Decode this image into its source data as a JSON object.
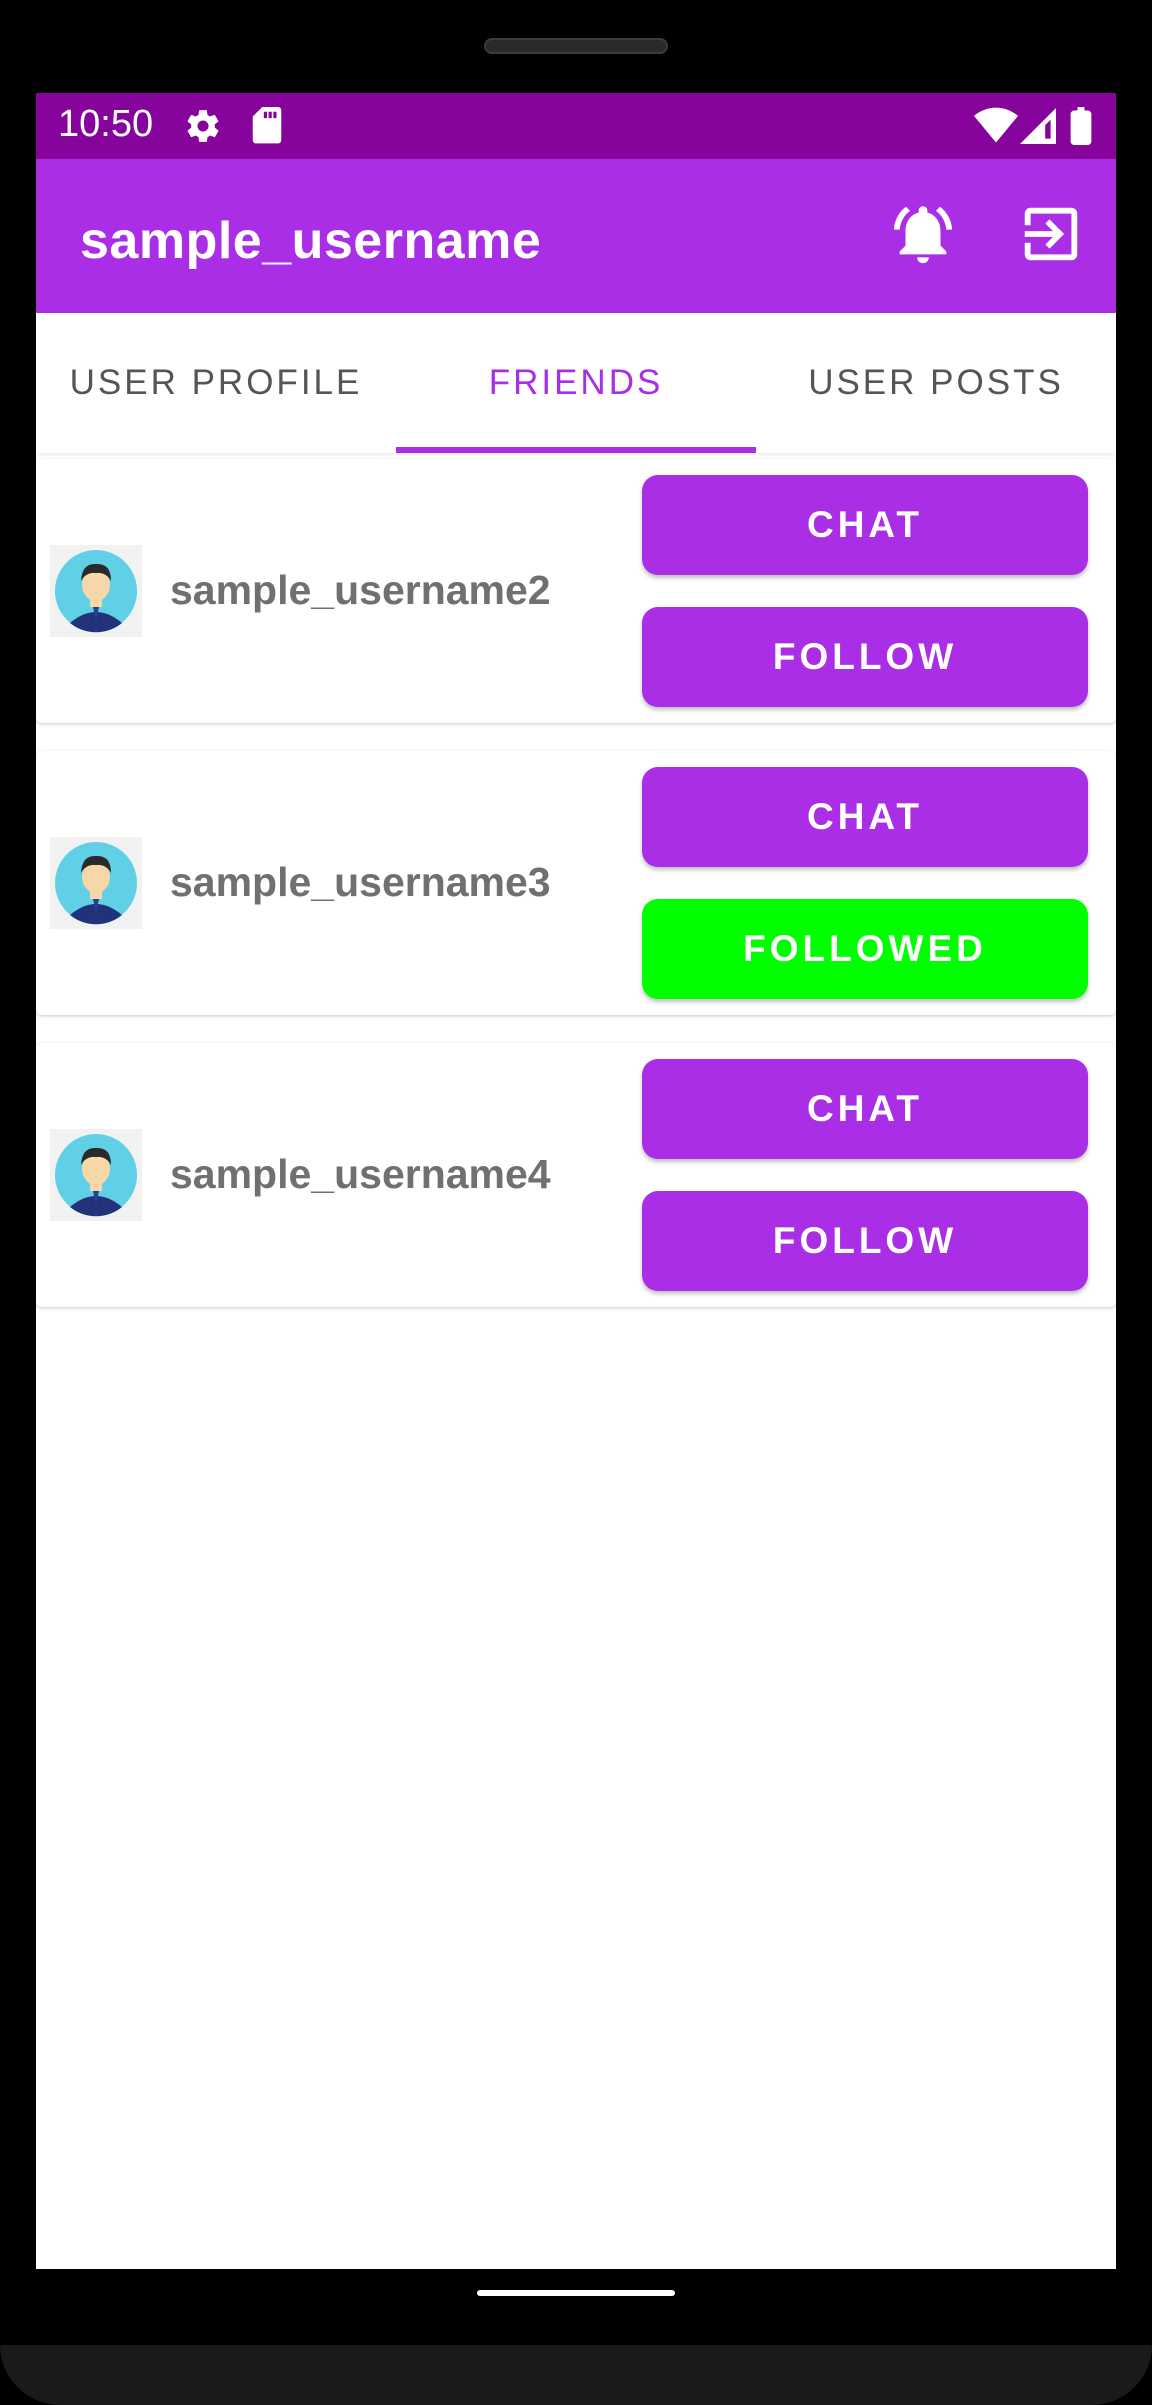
{
  "status_bar": {
    "time": "10:50",
    "icons": [
      "settings-icon",
      "sd-card-icon",
      "wifi-icon",
      "signal-icon",
      "battery-icon"
    ],
    "background": "#87049c"
  },
  "app_bar": {
    "title": "sample_username",
    "actions": [
      "notification-bell-icon",
      "logout-icon"
    ],
    "background": "#a92ee5"
  },
  "tabs": {
    "items": [
      {
        "label": "USER PROFILE",
        "active": false
      },
      {
        "label": "FRIENDS",
        "active": true
      },
      {
        "label": "USER POSTS",
        "active": false
      }
    ],
    "accent": "#a92ee5"
  },
  "friends": [
    {
      "username": "sample_username2",
      "chat_label": "CHAT",
      "follow_label": "FOLLOW",
      "followed": false
    },
    {
      "username": "sample_username3",
      "chat_label": "CHAT",
      "follow_label": "FOLLOWED",
      "followed": true
    },
    {
      "username": "sample_username4",
      "chat_label": "CHAT",
      "follow_label": "FOLLOW",
      "followed": false
    }
  ],
  "colors": {
    "button": "#a92ee5",
    "followed_button": "#00ff00",
    "username_text": "#707070"
  }
}
